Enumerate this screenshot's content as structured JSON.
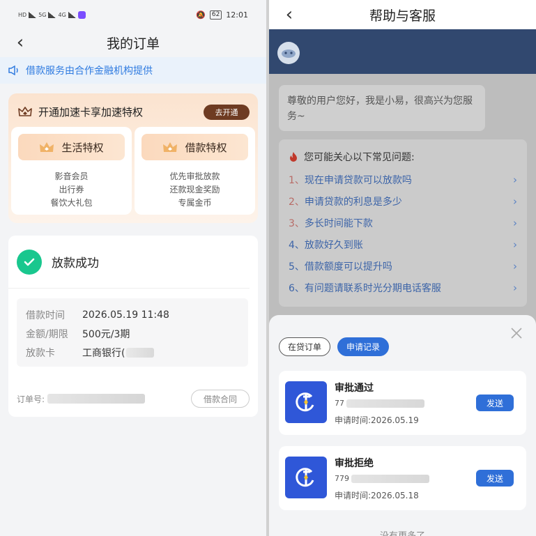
{
  "left": {
    "status": {
      "signal_a": "HD",
      "signal_b": "5G",
      "signal_c": "4G",
      "battery": "62",
      "time": "12:01"
    },
    "nav_title": "我的订单",
    "notice": "借款服务由合作金融机构提供",
    "promo": {
      "title": "开通加速卡享加速特权",
      "open_button": "去开通",
      "perks": [
        {
          "name": "生活特权",
          "lines": [
            "影音会员",
            "出行券",
            "餐饮大礼包"
          ]
        },
        {
          "name": "借款特权",
          "lines": [
            "优先审批放款",
            "还款现金奖励",
            "专属金币"
          ]
        }
      ]
    },
    "order": {
      "status": "放款成功",
      "rows": [
        {
          "key": "借款时间",
          "value": "2026.05.19 11:48"
        },
        {
          "key": "金额/期限",
          "value": "500元/3期"
        },
        {
          "key": "放款卡",
          "value": "工商银行("
        }
      ],
      "order_no_label": "订单号:",
      "contract_button": "借款合同"
    }
  },
  "right": {
    "nav_title": "帮助与客服",
    "greeting": "尊敬的用户您好，我是小易，很高兴为您服务~",
    "faq_title": "您可能关心以下常见问题:",
    "faq": [
      {
        "num": "1、",
        "text": "现在申请贷款可以放款吗"
      },
      {
        "num": "2、",
        "text": "申请贷款的利息是多少"
      },
      {
        "num": "3、",
        "text": "多长时间能下款"
      },
      {
        "num": "4、",
        "text": "放款好久到账"
      },
      {
        "num": "5、",
        "text": "借款额度可以提升吗"
      },
      {
        "num": "6、",
        "text": "有问题请联系时光分期电话客服"
      }
    ],
    "sheet": {
      "tabs": [
        "在贷订单",
        "申请记录"
      ],
      "records": [
        {
          "title": "审批通过",
          "id_prefix": "77",
          "date": "申请时间:2026.05.19",
          "button": "发送"
        },
        {
          "title": "审批拒绝",
          "id_prefix": "779",
          "date": "申请时间:2026.05.18",
          "button": "发送"
        }
      ],
      "more_text": "没有更多了"
    }
  },
  "colors": {
    "accent": "#2f6fd8",
    "success": "#19c78e",
    "promo_btn": "#6e3b22",
    "banner": "#31486f"
  }
}
